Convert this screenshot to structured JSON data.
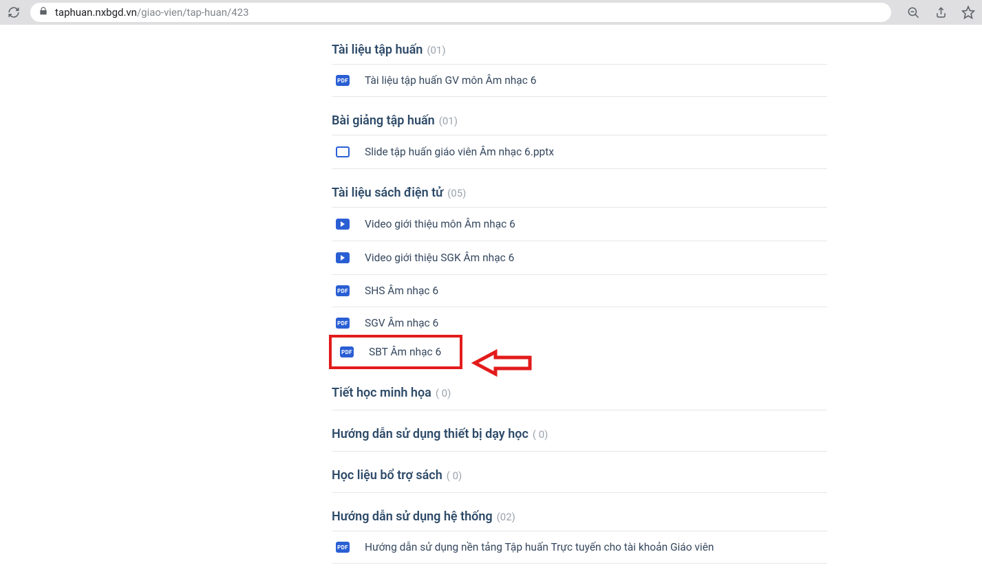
{
  "url": {
    "domain": "taphuan.nxbgd.vn",
    "path": "/giao-vien/tap-huan/423"
  },
  "sections": [
    {
      "title": "Tài liệu tập huấn",
      "count": "(01)",
      "items": [
        {
          "type": "pdf",
          "label": "Tài liệu tập huấn GV môn Âm nhạc 6"
        }
      ]
    },
    {
      "title": "Bài giảng tập huấn",
      "count": "(01)",
      "items": [
        {
          "type": "slide",
          "label": "Slide tập huấn giáo viên Âm nhạc 6.pptx"
        }
      ]
    },
    {
      "title": "Tài liệu sách điện tử",
      "count": "(05)",
      "items": [
        {
          "type": "video",
          "label": "Video giới thiệu môn Âm nhạc 6"
        },
        {
          "type": "video",
          "label": "Video giới thiệu SGK Âm nhạc 6"
        },
        {
          "type": "pdf",
          "label": "SHS Âm nhạc 6"
        },
        {
          "type": "pdf",
          "label": "SGV Âm nhạc 6"
        },
        {
          "type": "pdf",
          "label": "SBT Âm nhạc 6",
          "highlight": true
        }
      ]
    },
    {
      "title": "Tiết học minh họa",
      "count": "( 0)",
      "items": []
    },
    {
      "title": "Hướng dẫn sử dụng thiết bị dạy học",
      "count": "( 0)",
      "items": []
    },
    {
      "title": "Học liệu bổ trợ sách",
      "count": "( 0)",
      "items": []
    },
    {
      "title": "Hướng dẫn sử dụng hệ thống",
      "count": "(02)",
      "items": [
        {
          "type": "pdf",
          "label": "Hướng dẫn sử dụng nền tảng Tập huấn Trực tuyến cho tài khoản Giáo viên"
        }
      ]
    }
  ],
  "pdf_text": "PDF"
}
